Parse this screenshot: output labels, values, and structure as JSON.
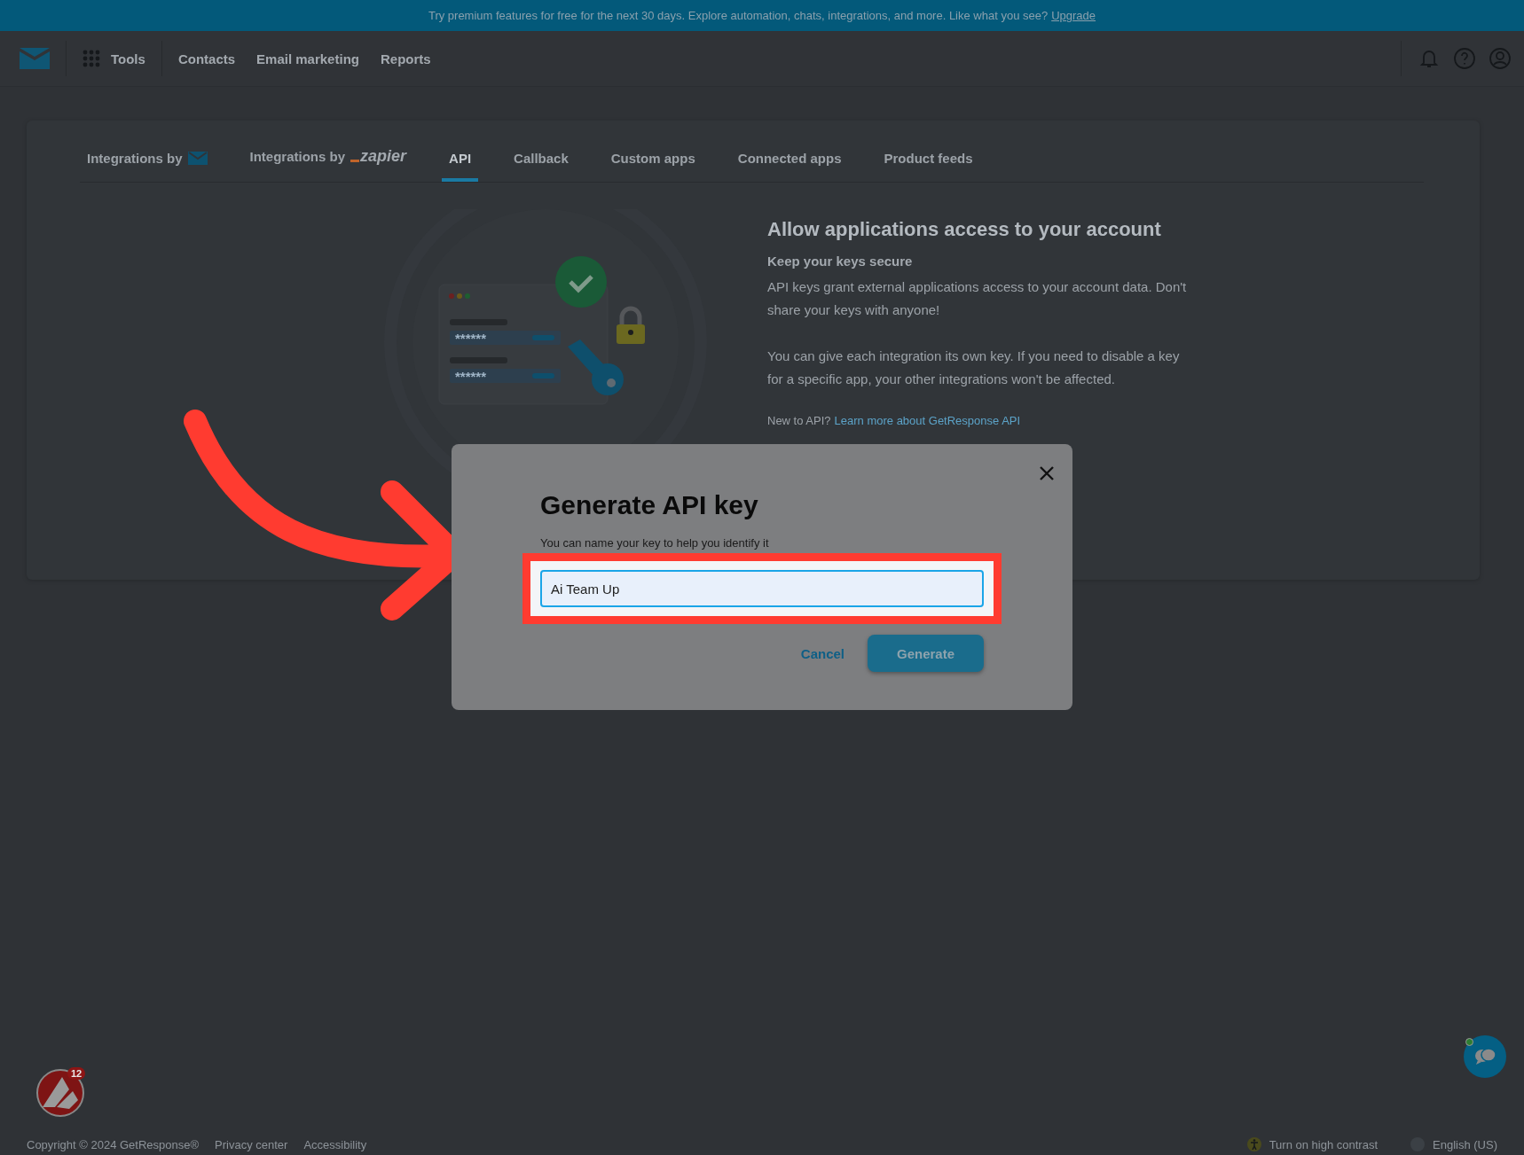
{
  "banner": {
    "text": "Try premium features for free for the next 30 days. Explore automation, chats, integrations, and more. Like what you see?",
    "link": "Upgrade"
  },
  "nav": {
    "tools": "Tools",
    "items": [
      "Contacts",
      "Email marketing",
      "Reports"
    ]
  },
  "tabs": [
    {
      "label": "Integrations by",
      "kind": "mail",
      "selected": false
    },
    {
      "label": "Integrations by",
      "kind": "zapier",
      "logo_text": "zapier",
      "selected": false
    },
    {
      "label": "API",
      "kind": "text",
      "selected": true
    },
    {
      "label": "Callback",
      "kind": "text",
      "selected": false
    },
    {
      "label": "Custom apps",
      "kind": "text",
      "selected": false
    },
    {
      "label": "Connected apps",
      "kind": "text",
      "selected": false
    },
    {
      "label": "Product feeds",
      "kind": "text",
      "selected": false
    }
  ],
  "illustration": {
    "masked_keys": [
      "******",
      "******"
    ]
  },
  "info": {
    "title": "Allow applications access to your account",
    "subtitle": "Keep your keys secure",
    "paragraphs": [
      "API keys grant external applications access to your account data. Don't share your keys with anyone!",
      "You can give each integration its own key. If you need to disable a key for a specific app, your other integrations won't be affected."
    ],
    "help_prefix": "New to API?",
    "help_link": "Learn more about GetResponse API"
  },
  "dialog": {
    "title": "Generate API key",
    "field_label": "You can name your key to help you identify it",
    "field_value": "Ai Team Up",
    "cancel": "Cancel",
    "generate": "Generate"
  },
  "badge": {
    "count": "12"
  },
  "footer": {
    "copyright": "Copyright © 2024 GetResponse®",
    "links": [
      "Privacy center",
      "Accessibility"
    ],
    "contrast": "Turn on high contrast",
    "language": "English (US)"
  }
}
